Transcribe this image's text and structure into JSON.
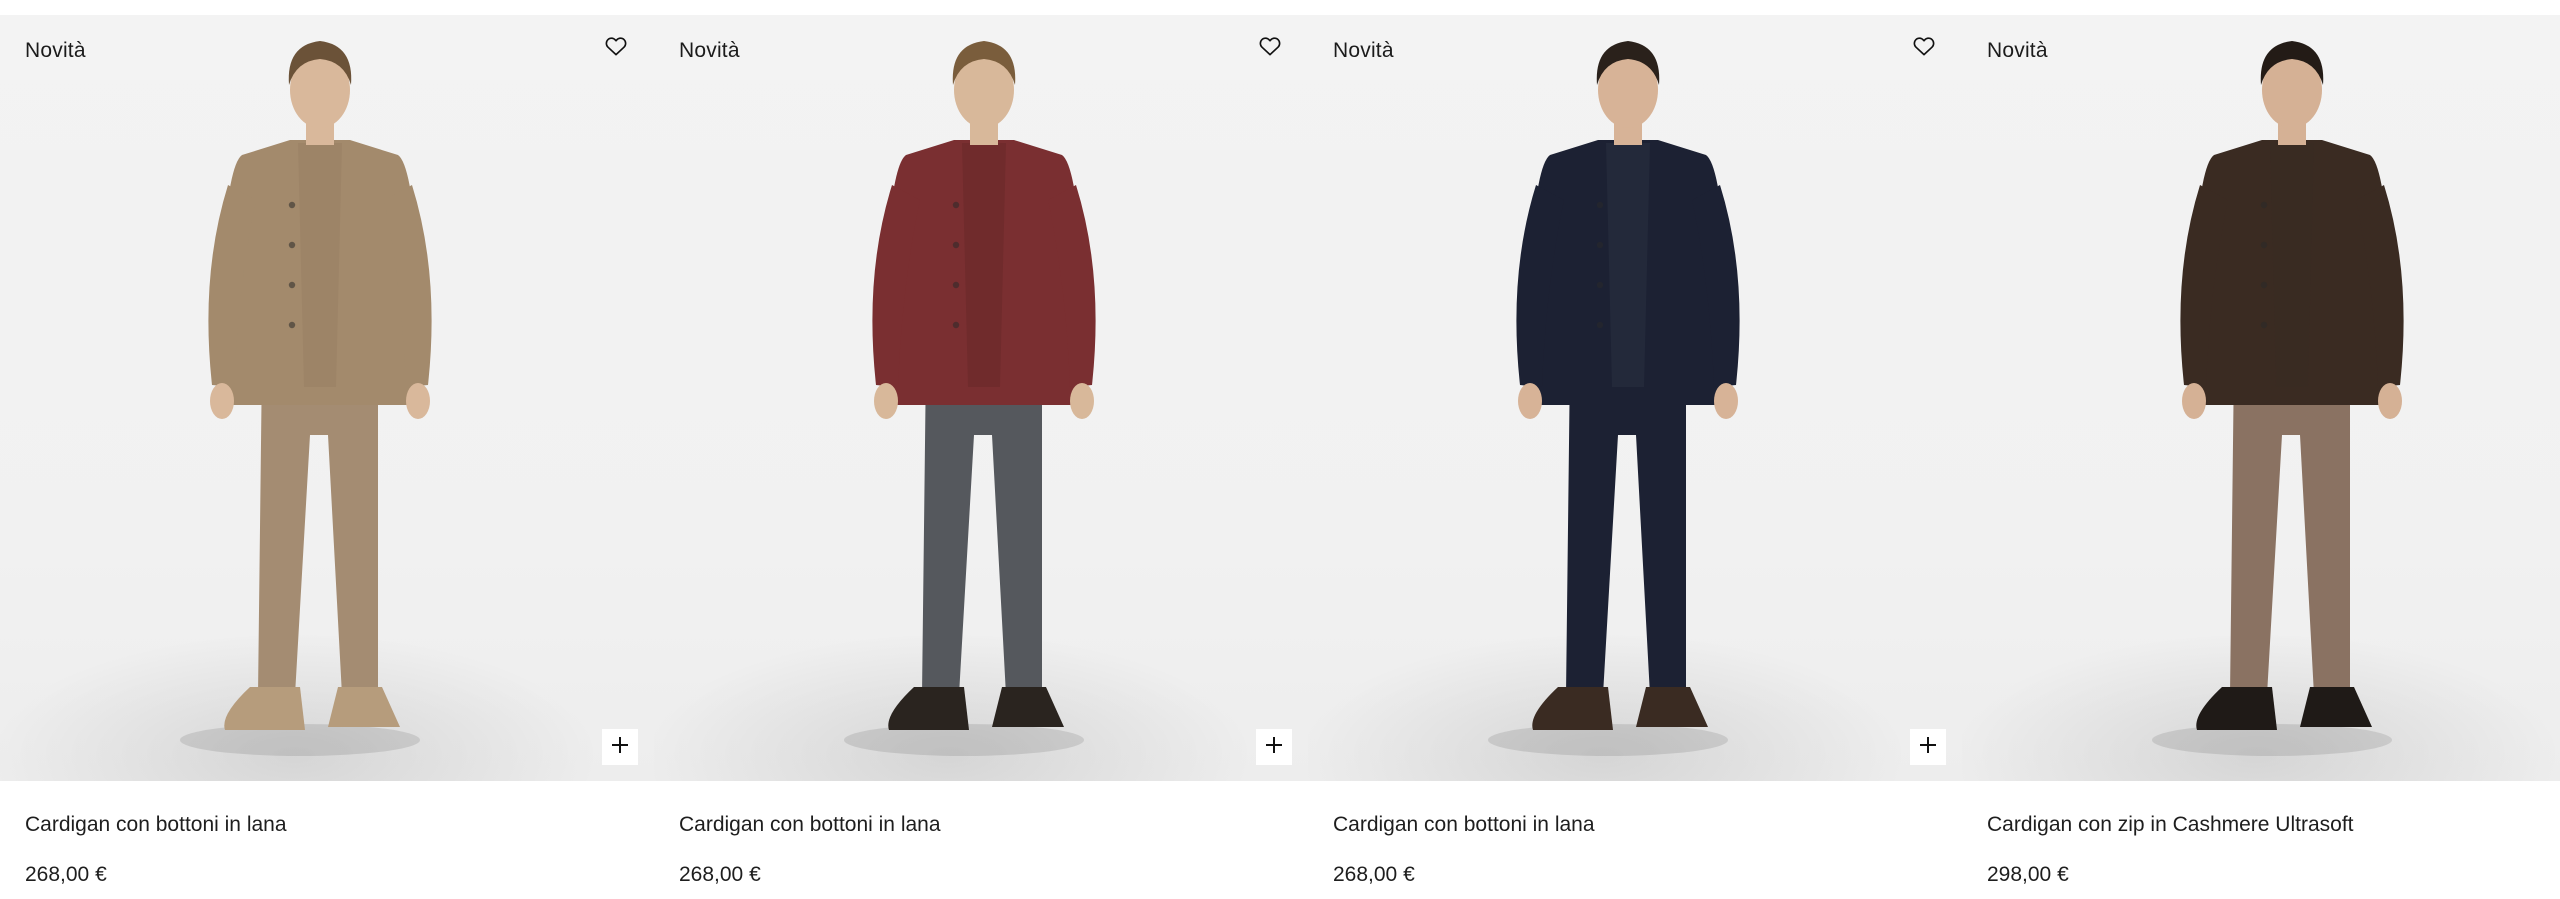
{
  "products": [
    {
      "badge": "Novità",
      "name": "Cardigan con bottoni in lana",
      "price": "268,00 €",
      "colors": {
        "top": "#a38a6c",
        "shirt": "#9c8266",
        "pants": "#a48c72",
        "shoes": "#b69c7c",
        "skin": "#d9b89b",
        "hair": "#6b5238"
      }
    },
    {
      "badge": "Novità",
      "name": "Cardigan con bottoni in lana",
      "price": "268,00 €",
      "colors": {
        "top": "#7a2f31",
        "shirt": "#6f2a2c",
        "pants": "#55585d",
        "shoes": "#2a241f",
        "skin": "#d8b89a",
        "hair": "#7a5d3c"
      }
    },
    {
      "badge": "Novità",
      "name": "Cardigan con bottoni in lana",
      "price": "268,00 €",
      "colors": {
        "top": "#1c2133",
        "shirt": "#242a3c",
        "pants": "#1c2133",
        "shoes": "#3a2b22",
        "skin": "#d7b397",
        "hair": "#2a211b"
      }
    },
    {
      "badge": "Novità",
      "name": "Cardigan con zip in Cashmere Ultrasoft",
      "price": "298,00 €",
      "colors": {
        "top": "#3a2b22",
        "shirt": "#3a2b22",
        "pants": "#8a7262",
        "shoes": "#1f1a17",
        "skin": "#d5b195",
        "hair": "#231b16"
      }
    }
  ],
  "icons": {
    "wishlist": "heart-icon",
    "add": "plus-icon"
  }
}
